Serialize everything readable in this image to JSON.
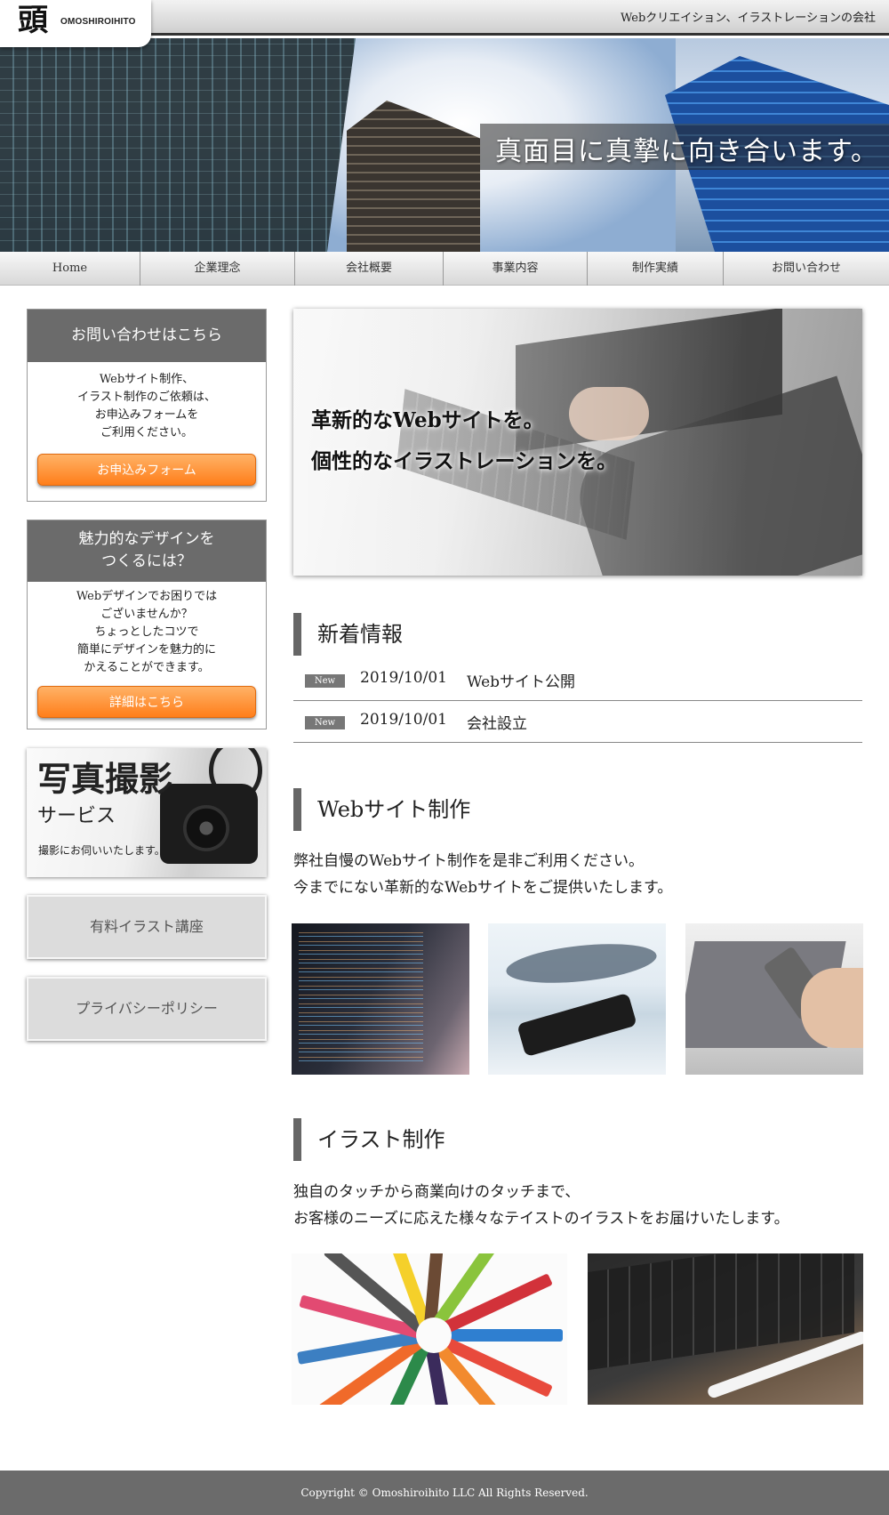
{
  "header": {
    "logo_mark": "頭",
    "logo_text": "OMOSHIROIHITO",
    "tagline": "Webクリエイション、イラストレーションの会社"
  },
  "hero": {
    "headline": "真面目に真摯に向き合います。"
  },
  "nav": {
    "items": [
      "Home",
      "企業理念",
      "会社概要",
      "事業内容",
      "制作実績",
      "お問い合わせ"
    ]
  },
  "sidebar": {
    "contact": {
      "title": "お問い合わせはこちら",
      "lines": [
        "Webサイト制作、",
        "イラスト制作のご依頼は、",
        "お申込みフォームを",
        "ご利用ください。"
      ],
      "button": "お申込みフォーム"
    },
    "design": {
      "title_lines": [
        "魅力的なデザインを",
        "つくるには？"
      ],
      "lines": [
        "Webデザインでお困りでは",
        "ございませんか？",
        "ちょっとしたコツで",
        "簡単にデザインを魅力的に",
        "かえることができます。"
      ],
      "button": "詳細はこちら"
    },
    "photo": {
      "title": "写真撮影",
      "subtitle": "サービス",
      "caption": "撮影にお伺いいたします。"
    },
    "buttons": [
      "有料イラスト講座",
      "プライバシーポリシー"
    ]
  },
  "main": {
    "hero_lines": [
      "革新的なWebサイトを。",
      "個性的なイラストレーションを。"
    ],
    "news": {
      "title": "新着情報",
      "items": [
        {
          "badge": "New",
          "date": "2019/10/01",
          "title": "Webサイト公開"
        },
        {
          "badge": "New",
          "date": "2019/10/01",
          "title": "会社設立"
        }
      ]
    },
    "web": {
      "title": "Webサイト制作",
      "lines": [
        "弊社自慢のWebサイト制作を是非ご利用ください。",
        "今までにない革新的なWebサイトをご提供いたします。"
      ]
    },
    "illust": {
      "title": "イラスト制作",
      "lines": [
        "独自のタッチから商業向けのタッチまで、",
        "お客様のニーズに応えた様々なテイストのイラストをお届けいたします。"
      ]
    }
  },
  "footer": {
    "copyright": "Copyright © Omoshiroihito LLC All Rights Reserved."
  },
  "colors": {
    "accent_orange": "#ff8a2a",
    "header_gray": "#6b6b6b",
    "footer_gray": "#6b6b6b"
  }
}
